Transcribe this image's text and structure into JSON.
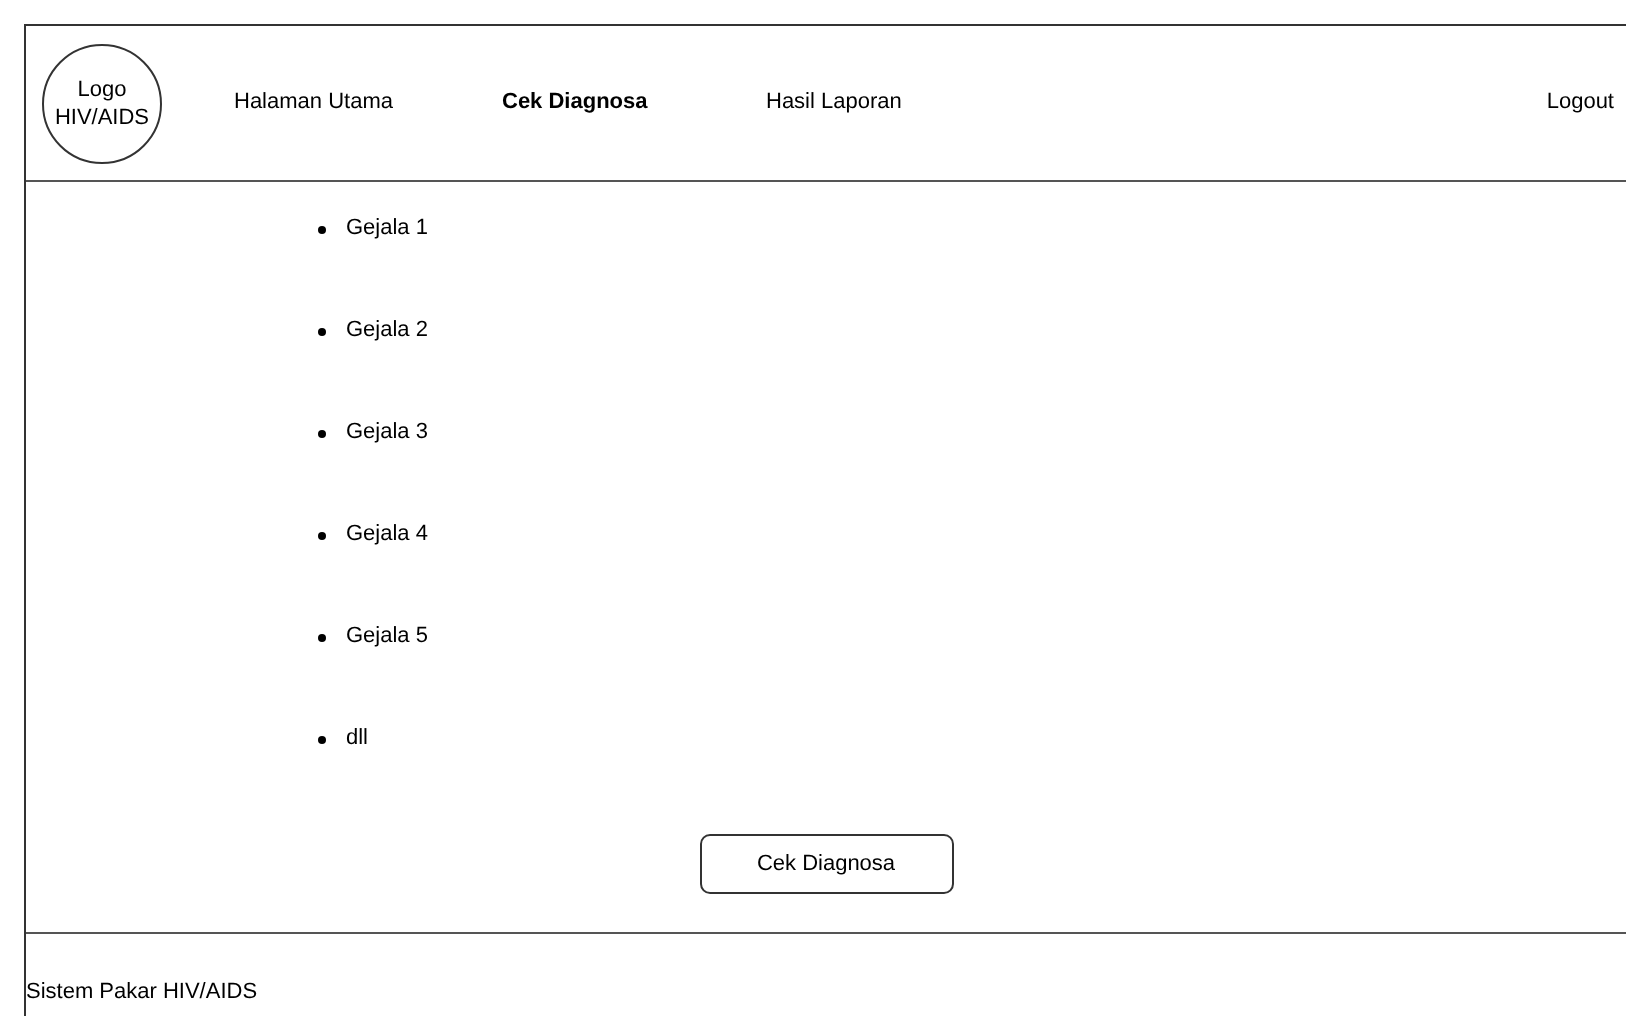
{
  "header": {
    "logo": "Logo HIV/AIDS",
    "nav": [
      {
        "label": "Halaman Utama",
        "selected": false
      },
      {
        "label": "Cek Diagnosa",
        "selected": true
      },
      {
        "label": "Hasil Laporan",
        "selected": false
      }
    ],
    "logout": "Logout"
  },
  "symptoms": [
    "Gejala 1",
    "Gejala 2",
    "Gejala 3",
    "Gejala 4",
    "Gejala 5",
    "dll"
  ],
  "button": "Cek Diagnosa",
  "footer": "Sistem Pakar HIV/AIDS"
}
